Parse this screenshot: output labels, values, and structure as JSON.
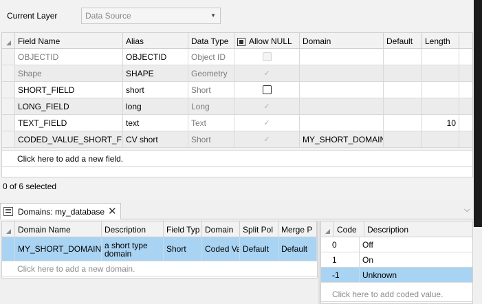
{
  "current_layer": {
    "label": "Current Layer",
    "value": "Data Source"
  },
  "fields_table": {
    "columns": [
      "Field Name",
      "Alias",
      "Data Type",
      "Allow NULL",
      "Domain",
      "Default",
      "Length"
    ],
    "rows": [
      {
        "field_name": "OBJECTID",
        "alias": "OBJECTID",
        "data_type": "Object ID",
        "allow_null": "disabled-unchecked",
        "domain": "",
        "default": "",
        "length": ""
      },
      {
        "field_name": "Shape",
        "alias": "SHAPE",
        "data_type": "Geometry",
        "allow_null": "checked-readonly",
        "domain": "",
        "default": "",
        "length": ""
      },
      {
        "field_name": "SHORT_FIELD",
        "alias": "short",
        "data_type": "Short",
        "allow_null": "unchecked",
        "domain": "",
        "default": "",
        "length": ""
      },
      {
        "field_name": "LONG_FIELD",
        "alias": "long",
        "data_type": "Long",
        "allow_null": "checked-readonly",
        "domain": "",
        "default": "",
        "length": ""
      },
      {
        "field_name": "TEXT_FIELD",
        "alias": "text",
        "data_type": "Text",
        "allow_null": "checked-readonly",
        "domain": "",
        "default": "",
        "length": "10"
      },
      {
        "field_name": "CODED_VALUE_SHORT_FIELD",
        "alias": "CV short",
        "data_type": "Short",
        "allow_null": "checked-readonly",
        "domain": "MY_SHORT_DOMAIN",
        "default": "",
        "length": ""
      }
    ],
    "add_row": "Click here to add a new field.",
    "selection_status": "0 of 6 selected"
  },
  "domains_panel": {
    "tab_label": "Domains: my_database",
    "columns": [
      "Domain Name",
      "Description",
      "Field Typ",
      "Domain",
      "Split Pol",
      "Merge P"
    ],
    "rows": [
      {
        "name": "MY_SHORT_DOMAIN",
        "description": "a short type domain",
        "field_type": "Short",
        "domain_type": "Coded Va",
        "split_policy": "Default",
        "merge_policy": "Default"
      }
    ],
    "add_row": "Click here to add a new domain."
  },
  "coded_values": {
    "columns": [
      "Code",
      "Description"
    ],
    "rows": [
      {
        "code": "0",
        "description": "Off"
      },
      {
        "code": "1",
        "description": "On"
      },
      {
        "code": "-1",
        "description": "Unknown"
      }
    ],
    "add_row": "Click here to add coded value."
  },
  "icons": {
    "dropdown": "chevron-down-icon",
    "close": "close-icon",
    "database": "database-icon",
    "sort_corner": "sort-corner-icon"
  },
  "colors": {
    "selection": "#a9d3f2",
    "shaded_row": "#ececec"
  }
}
